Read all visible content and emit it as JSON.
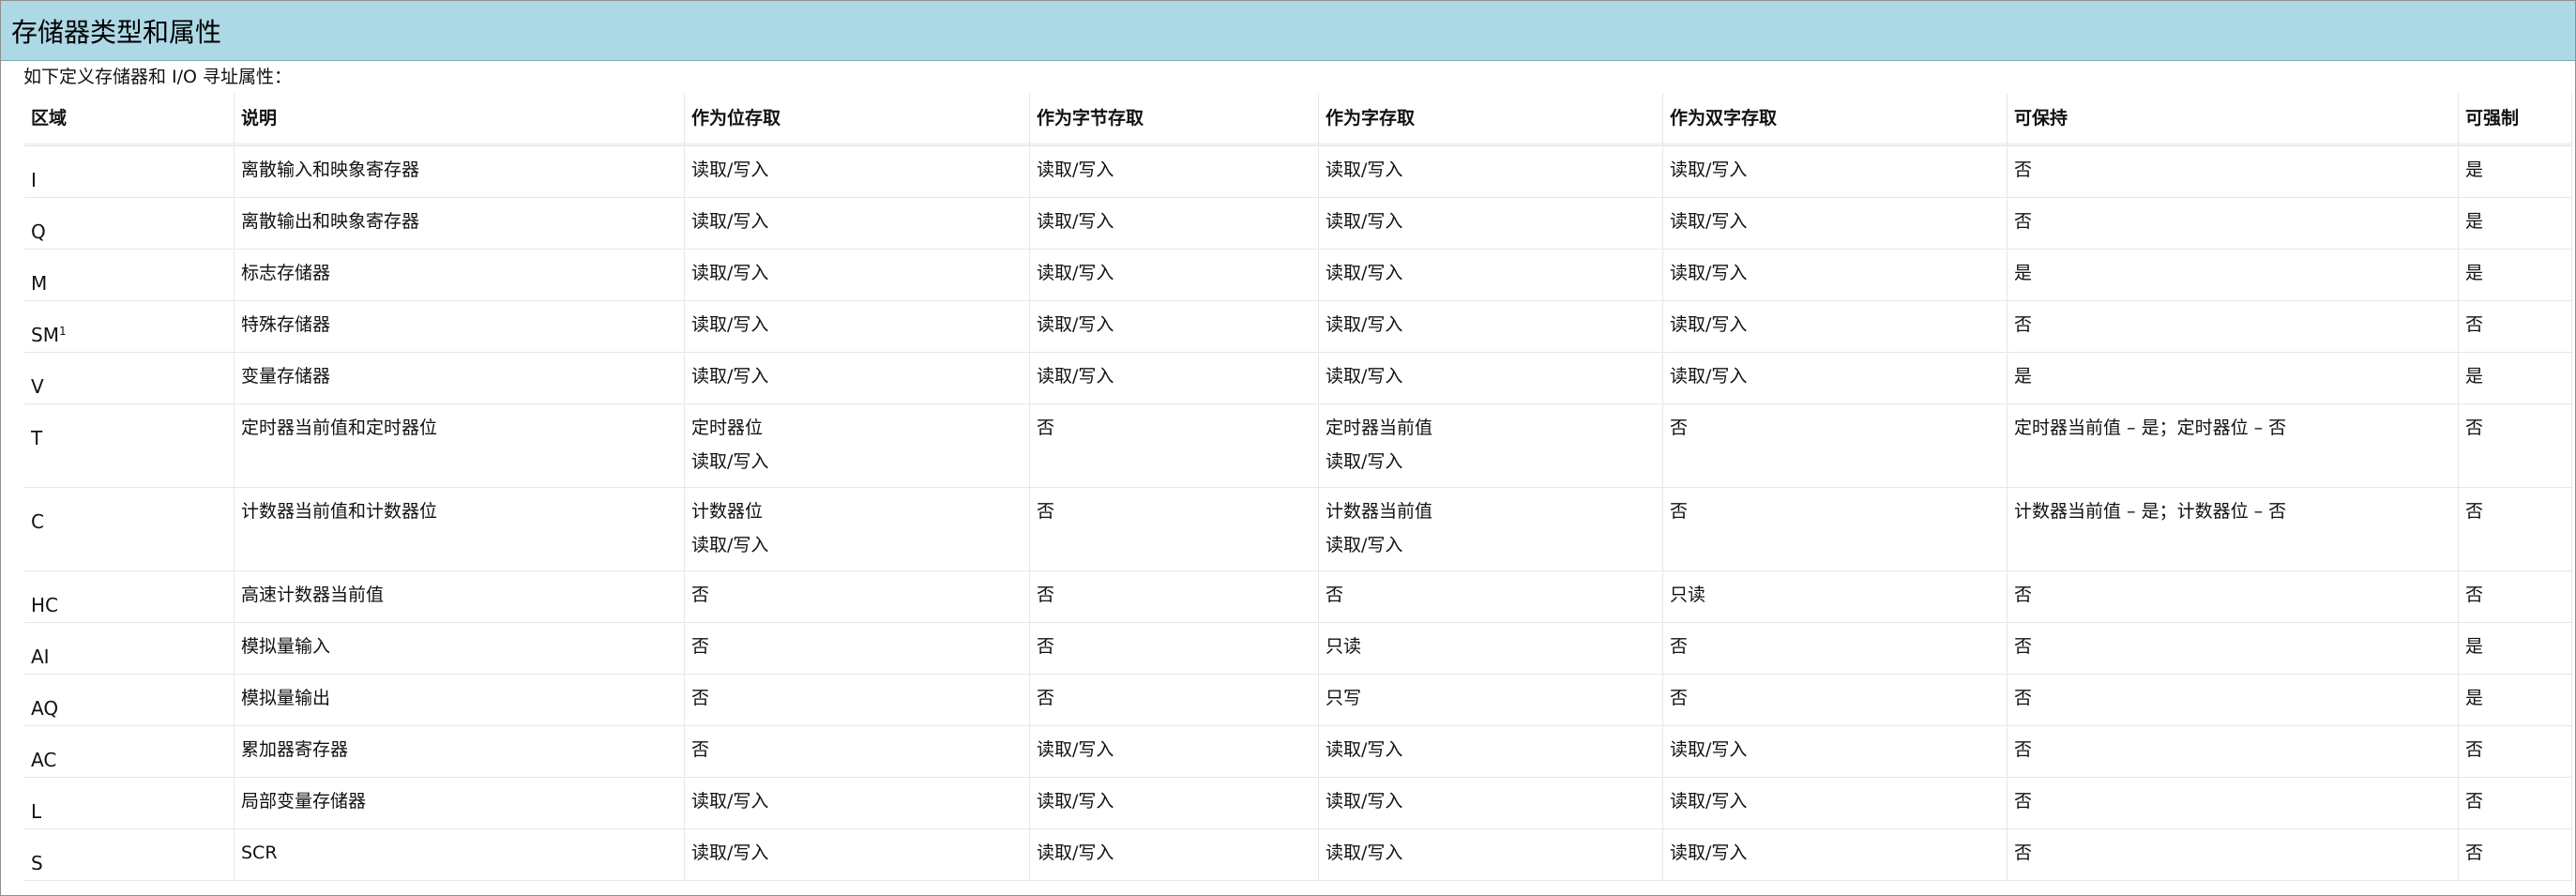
{
  "page": {
    "title": "存储器类型和属性",
    "intro": "如下定义存储器和 I/O 寻址属性："
  },
  "table": {
    "headers": [
      "区域",
      "说明",
      "作为位存取",
      "作为字节存取",
      "作为字存取",
      "作为双字存取",
      "可保持",
      "可强制"
    ],
    "rows": [
      {
        "area": "I",
        "sup": "",
        "desc": "离散输入和映象寄存器",
        "bit": [
          "读取/写入"
        ],
        "byte": [
          "读取/写入"
        ],
        "word": [
          "读取/写入"
        ],
        "dword": [
          "读取/写入"
        ],
        "retain": [
          "否"
        ],
        "force": [
          "是"
        ]
      },
      {
        "area": "Q",
        "sup": "",
        "desc": "离散输出和映象寄存器",
        "bit": [
          "读取/写入"
        ],
        "byte": [
          "读取/写入"
        ],
        "word": [
          "读取/写入"
        ],
        "dword": [
          "读取/写入"
        ],
        "retain": [
          "否"
        ],
        "force": [
          "是"
        ]
      },
      {
        "area": "M",
        "sup": "",
        "desc": "标志存储器",
        "bit": [
          "读取/写入"
        ],
        "byte": [
          "读取/写入"
        ],
        "word": [
          "读取/写入"
        ],
        "dword": [
          "读取/写入"
        ],
        "retain": [
          "是"
        ],
        "force": [
          "是"
        ]
      },
      {
        "area": "SM",
        "sup": "1",
        "desc": "特殊存储器",
        "bit": [
          "读取/写入"
        ],
        "byte": [
          "读取/写入"
        ],
        "word": [
          "读取/写入"
        ],
        "dword": [
          "读取/写入"
        ],
        "retain": [
          "否"
        ],
        "force": [
          "否"
        ]
      },
      {
        "area": "V",
        "sup": "",
        "desc": "变量存储器",
        "bit": [
          "读取/写入"
        ],
        "byte": [
          "读取/写入"
        ],
        "word": [
          "读取/写入"
        ],
        "dword": [
          "读取/写入"
        ],
        "retain": [
          "是"
        ],
        "force": [
          "是"
        ]
      },
      {
        "area": "T",
        "sup": "",
        "desc": "定时器当前值和定时器位",
        "bit": [
          "定时器位",
          "读取/写入"
        ],
        "byte": [
          "否"
        ],
        "word": [
          "定时器当前值",
          "读取/写入"
        ],
        "dword": [
          "否"
        ],
        "retain": [
          "定时器当前值 – 是；定时器位 – 否"
        ],
        "force": [
          "否"
        ]
      },
      {
        "area": "C",
        "sup": "",
        "desc": "计数器当前值和计数器位",
        "bit": [
          "计数器位",
          "读取/写入"
        ],
        "byte": [
          "否"
        ],
        "word": [
          "计数器当前值",
          "读取/写入"
        ],
        "dword": [
          "否"
        ],
        "retain": [
          "计数器当前值 – 是；计数器位 – 否"
        ],
        "force": [
          "否"
        ]
      },
      {
        "area": "HC",
        "sup": "",
        "desc": "高速计数器当前值",
        "bit": [
          "否"
        ],
        "byte": [
          "否"
        ],
        "word": [
          "否"
        ],
        "dword": [
          "只读"
        ],
        "retain": [
          "否"
        ],
        "force": [
          "否"
        ]
      },
      {
        "area": "AI",
        "sup": "",
        "desc": "模拟量输入",
        "bit": [
          "否"
        ],
        "byte": [
          "否"
        ],
        "word": [
          "只读"
        ],
        "dword": [
          "否"
        ],
        "retain": [
          "否"
        ],
        "force": [
          "是"
        ]
      },
      {
        "area": "AQ",
        "sup": "",
        "desc": "模拟量输出",
        "bit": [
          "否"
        ],
        "byte": [
          "否"
        ],
        "word": [
          "只写"
        ],
        "dword": [
          "否"
        ],
        "retain": [
          "否"
        ],
        "force": [
          "是"
        ]
      },
      {
        "area": "AC",
        "sup": "",
        "desc": "累加器寄存器",
        "bit": [
          "否"
        ],
        "byte": [
          "读取/写入"
        ],
        "word": [
          "读取/写入"
        ],
        "dword": [
          "读取/写入"
        ],
        "retain": [
          "否"
        ],
        "force": [
          "否"
        ]
      },
      {
        "area": "L",
        "sup": "",
        "desc": "局部变量存储器",
        "bit": [
          "读取/写入"
        ],
        "byte": [
          "读取/写入"
        ],
        "word": [
          "读取/写入"
        ],
        "dword": [
          "读取/写入"
        ],
        "retain": [
          "否"
        ],
        "force": [
          "否"
        ]
      },
      {
        "area": "S",
        "sup": "",
        "desc": "SCR",
        "bit": [
          "读取/写入"
        ],
        "byte": [
          "读取/写入"
        ],
        "word": [
          "读取/写入"
        ],
        "dword": [
          "读取/写入"
        ],
        "retain": [
          "否"
        ],
        "force": [
          "否"
        ]
      }
    ]
  }
}
